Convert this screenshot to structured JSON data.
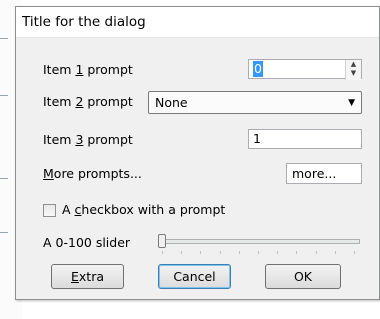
{
  "dialog": {
    "title": "Title for the dialog"
  },
  "item1": {
    "prompt_pre": "Item ",
    "prompt_key": "1",
    "prompt_post": " prompt",
    "value": "0"
  },
  "item2": {
    "prompt_pre": "Item ",
    "prompt_key": "2",
    "prompt_post": " prompt",
    "value": "None"
  },
  "item3": {
    "prompt_pre": "Item ",
    "prompt_key": "3",
    "prompt_post": " prompt",
    "value": "1"
  },
  "more": {
    "prompt_key": "M",
    "prompt_post": "ore prompts...",
    "button_label": "more..."
  },
  "checkbox": {
    "label_pre": "A ",
    "label_key": "c",
    "label_post": "heckbox with a prompt",
    "checked": false
  },
  "slider": {
    "label": "A 0-100 slider",
    "value": 0
  },
  "buttons": {
    "extra_key": "E",
    "extra_post": "xtra",
    "cancel": "Cancel",
    "ok": "OK"
  }
}
